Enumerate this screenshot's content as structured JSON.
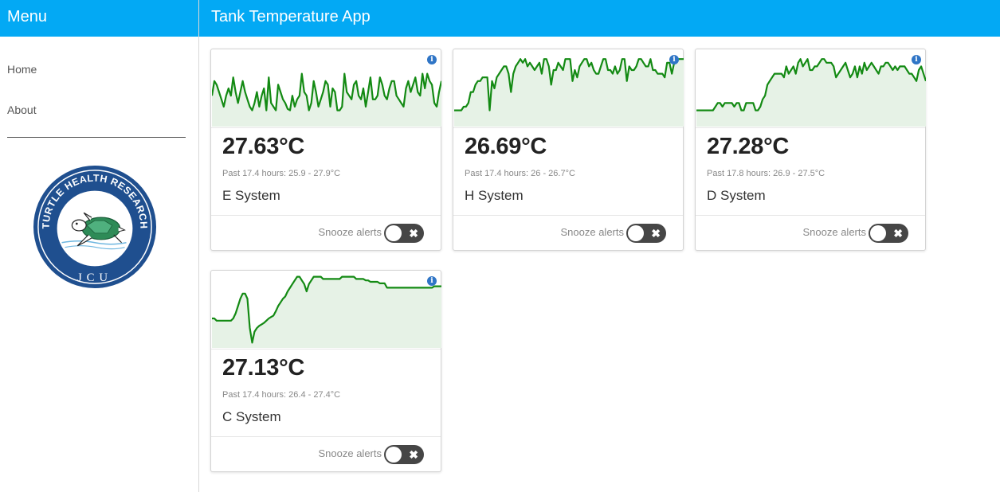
{
  "sidebar": {
    "title": "Menu",
    "nav": [
      {
        "label": "Home"
      },
      {
        "label": "About"
      }
    ],
    "logo": {
      "top_text": "TURTLE HEALTH RESEARCH",
      "bottom_text": "JCU"
    }
  },
  "header": {
    "title": "Tank Temperature App"
  },
  "cards": [
    {
      "temperature": "27.63°C",
      "range": "Past 17.4 hours: 25.9 - 27.9°C",
      "name": "E System",
      "snooze_label": "Snooze alerts",
      "snoozed": false,
      "chart_data": {
        "type": "area",
        "color": "#138a13",
        "fill": "#e6f2e6",
        "values": [
          60,
          40,
          45,
          55,
          65,
          75,
          60,
          50,
          60,
          35,
          55,
          70,
          55,
          40,
          55,
          65,
          75,
          80,
          70,
          55,
          75,
          60,
          50,
          80,
          35,
          70,
          75,
          80,
          45,
          55,
          65,
          70,
          78,
          80,
          60,
          75,
          65,
          60,
          30,
          55,
          60,
          80,
          70,
          40,
          55,
          75,
          65,
          55,
          40,
          45,
          75,
          50,
          55,
          80,
          80,
          75,
          30,
          55,
          60,
          65,
          45,
          40,
          60,
          65,
          50,
          75,
          55,
          35,
          65,
          65,
          60,
          35,
          45,
          60,
          65,
          50,
          40,
          40,
          60,
          65,
          70,
          75,
          50,
          40,
          55,
          45,
          35,
          55,
          60,
          30,
          50,
          30,
          40,
          45,
          70,
          75,
          55,
          40
        ]
      }
    },
    {
      "temperature": "26.69°C",
      "range": "Past 17.4 hours: 26 - 26.7°C",
      "name": "H System",
      "snooze_label": "Snooze alerts",
      "snoozed": false,
      "chart_data": {
        "type": "area",
        "color": "#138a13",
        "fill": "#e6f2e6",
        "values": [
          80,
          80,
          80,
          80,
          75,
          75,
          70,
          55,
          55,
          45,
          40,
          40,
          35,
          35,
          35,
          80,
          40,
          50,
          35,
          30,
          25,
          20,
          20,
          30,
          55,
          30,
          20,
          15,
          10,
          15,
          10,
          20,
          15,
          20,
          25,
          20,
          15,
          30,
          10,
          10,
          20,
          45,
          25,
          25,
          15,
          20,
          25,
          10,
          10,
          10,
          40,
          25,
          35,
          20,
          15,
          10,
          10,
          20,
          15,
          25,
          30,
          30,
          20,
          10,
          10,
          25,
          25,
          30,
          20,
          30,
          25,
          10,
          10,
          40,
          20,
          25,
          25,
          20,
          10,
          10,
          15,
          20,
          20,
          10,
          25,
          25,
          30,
          30,
          30,
          35,
          15,
          15,
          30,
          15,
          10,
          10,
          10,
          10
        ]
      }
    },
    {
      "temperature": "27.28°C",
      "range": "Past 17.8 hours: 26.9 - 27.5°C",
      "name": "D System",
      "snooze_label": "Snooze alerts",
      "snoozed": false,
      "chart_data": {
        "type": "area",
        "color": "#138a13",
        "fill": "#e6f2e6",
        "values": [
          80,
          80,
          80,
          80,
          80,
          80,
          80,
          80,
          75,
          70,
          70,
          75,
          70,
          70,
          70,
          70,
          75,
          70,
          70,
          80,
          80,
          70,
          70,
          70,
          70,
          80,
          80,
          75,
          65,
          60,
          45,
          40,
          35,
          30,
          30,
          30,
          30,
          35,
          20,
          30,
          25,
          20,
          30,
          15,
          10,
          20,
          15,
          10,
          25,
          25,
          20,
          20,
          15,
          10,
          10,
          15,
          15,
          15,
          20,
          35,
          30,
          25,
          20,
          15,
          25,
          35,
          30,
          20,
          35,
          20,
          30,
          15,
          25,
          20,
          15,
          20,
          25,
          30,
          20,
          20,
          15,
          15,
          20,
          25,
          20,
          25,
          20,
          20,
          20,
          25,
          30,
          30,
          35,
          40,
          25,
          20,
          30,
          40
        ]
      }
    },
    {
      "temperature": "27.13°C",
      "range": "Past 17.4 hours: 26.4 - 27.4°C",
      "name": "C System",
      "snooze_label": "Snooze alerts",
      "snoozed": false,
      "chart_data": {
        "type": "area",
        "color": "#138a13",
        "fill": "#e6f2e6",
        "values": [
          62,
          62,
          65,
          65,
          65,
          65,
          65,
          65,
          65,
          62,
          55,
          45,
          35,
          28,
          28,
          35,
          75,
          95,
          80,
          75,
          72,
          70,
          68,
          65,
          62,
          60,
          58,
          52,
          45,
          40,
          35,
          32,
          25,
          20,
          15,
          10,
          5,
          5,
          10,
          15,
          25,
          15,
          10,
          5,
          5,
          5,
          5,
          8,
          8,
          8,
          8,
          8,
          8,
          8,
          8,
          5,
          5,
          5,
          5,
          5,
          5,
          8,
          8,
          8,
          8,
          10,
          10,
          12,
          12,
          12,
          12,
          14,
          14,
          14,
          20,
          20,
          20,
          20,
          20,
          20,
          20,
          20,
          20,
          20,
          20,
          20,
          20,
          20,
          20,
          20,
          20,
          20,
          20,
          20,
          18,
          18,
          18,
          18
        ]
      }
    }
  ]
}
